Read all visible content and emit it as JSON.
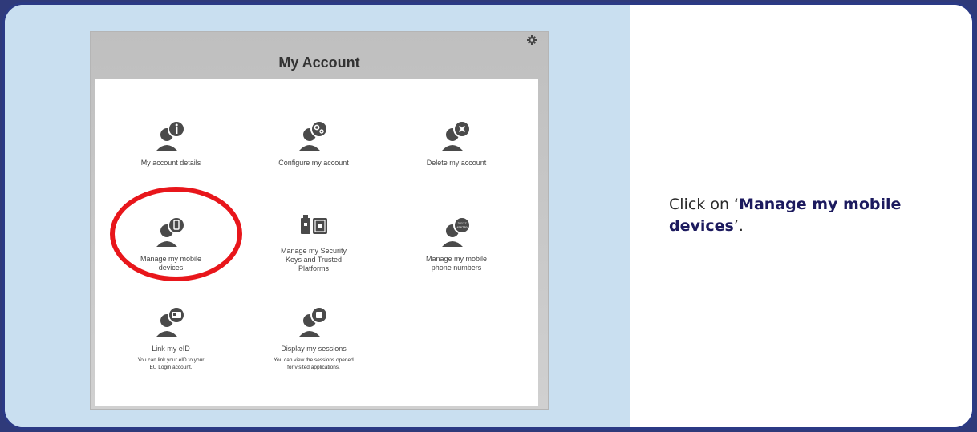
{
  "screenshot": {
    "title": "My Account",
    "tiles": [
      {
        "label": "My account details",
        "sub": ""
      },
      {
        "label": "Configure my account",
        "sub": ""
      },
      {
        "label": "Delete my account",
        "sub": ""
      },
      {
        "label": "Manage my mobile devices",
        "sub": ""
      },
      {
        "label": "Manage my Security Keys and Trusted Platforms",
        "sub": ""
      },
      {
        "label": "Manage my mobile phone numbers",
        "sub": ""
      },
      {
        "label": "Link my eID",
        "sub": "You can link your eID to your EU Login account."
      },
      {
        "label": "Display my sessions",
        "sub": "You can view the sessions opened for visited applications."
      }
    ],
    "icons": [
      "user-info-icon",
      "user-gears-icon",
      "user-delete-icon",
      "user-mobile-icon",
      "security-key-icon",
      "user-phone-numbers-icon",
      "user-eid-card-icon",
      "user-sessions-icon",
      "gear-icon"
    ],
    "phone_digits": "32137\n456789"
  },
  "instruction": {
    "prefix": "Click on ‘",
    "bold": "Manage my mobile devices",
    "suffix": "’."
  },
  "colors": {
    "highlight": "#e8161b",
    "accent": "#1c1a5e",
    "border": "#2b3a85"
  }
}
